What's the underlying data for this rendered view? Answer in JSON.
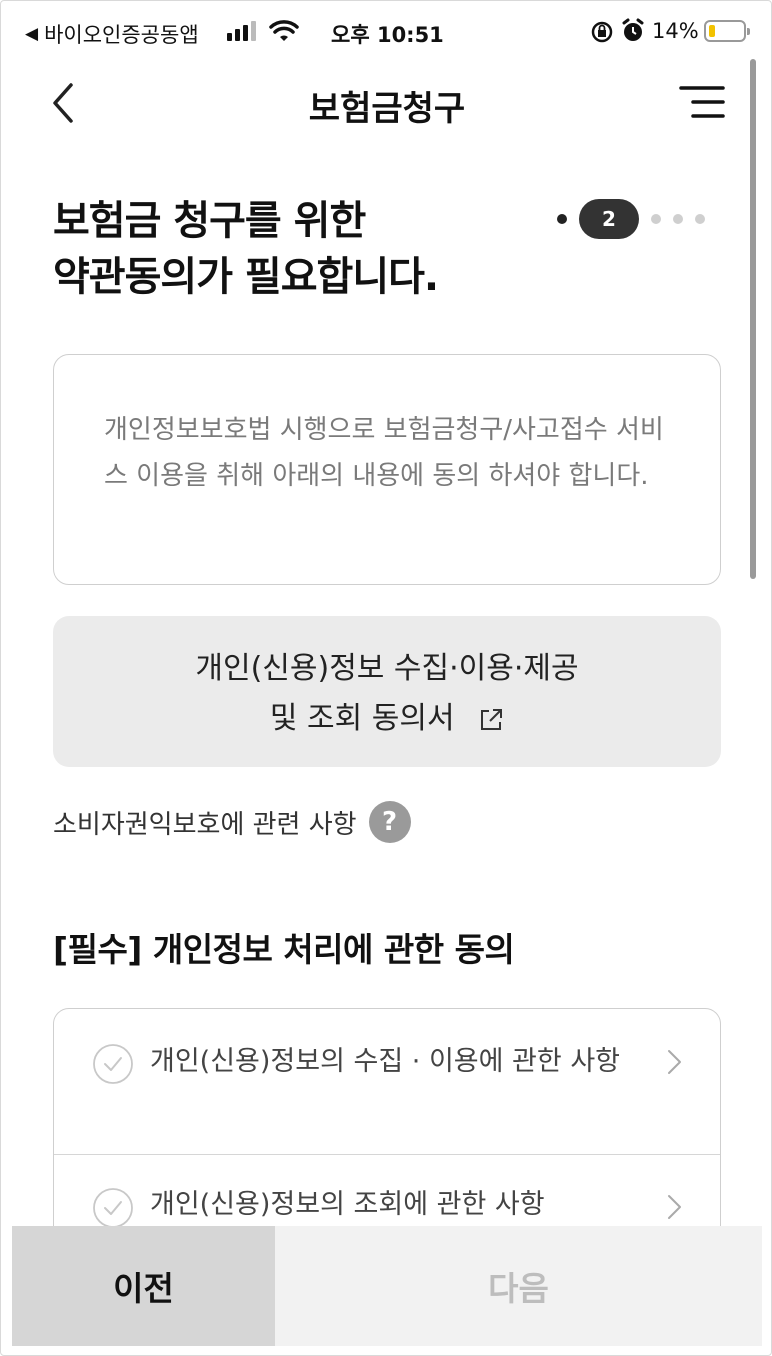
{
  "status_bar": {
    "back_app": "바이오인증공동앱",
    "time": "오후 10:51",
    "battery": "14%"
  },
  "header": {
    "title": "보험금청구"
  },
  "headline": {
    "line1": "보험금 청구를 위한",
    "line2": "약관동의가 필요합니다."
  },
  "stepper": {
    "current": "2"
  },
  "info": {
    "text": "개인정보보호법 시행으로 보험금청구/사고접수 서비스 이용을 취해 아래의 내용에 동의 하셔야 합니다."
  },
  "consent_doc": {
    "line1": "개인(신용)정보 수집·이용·제공",
    "line2": "및 조회 동의서"
  },
  "consumer": {
    "label": "소비자권익보호에 관련 사항"
  },
  "section": {
    "title": "[필수] 개인정보 처리에 관한 동의"
  },
  "agreements": [
    {
      "label": "개인(신용)정보의 수집 · 이용에 관한 사항"
    },
    {
      "label": "개인(신용)정보의 조회에 관한 사항"
    }
  ],
  "buttons": {
    "prev": "이전",
    "next": "다음"
  }
}
